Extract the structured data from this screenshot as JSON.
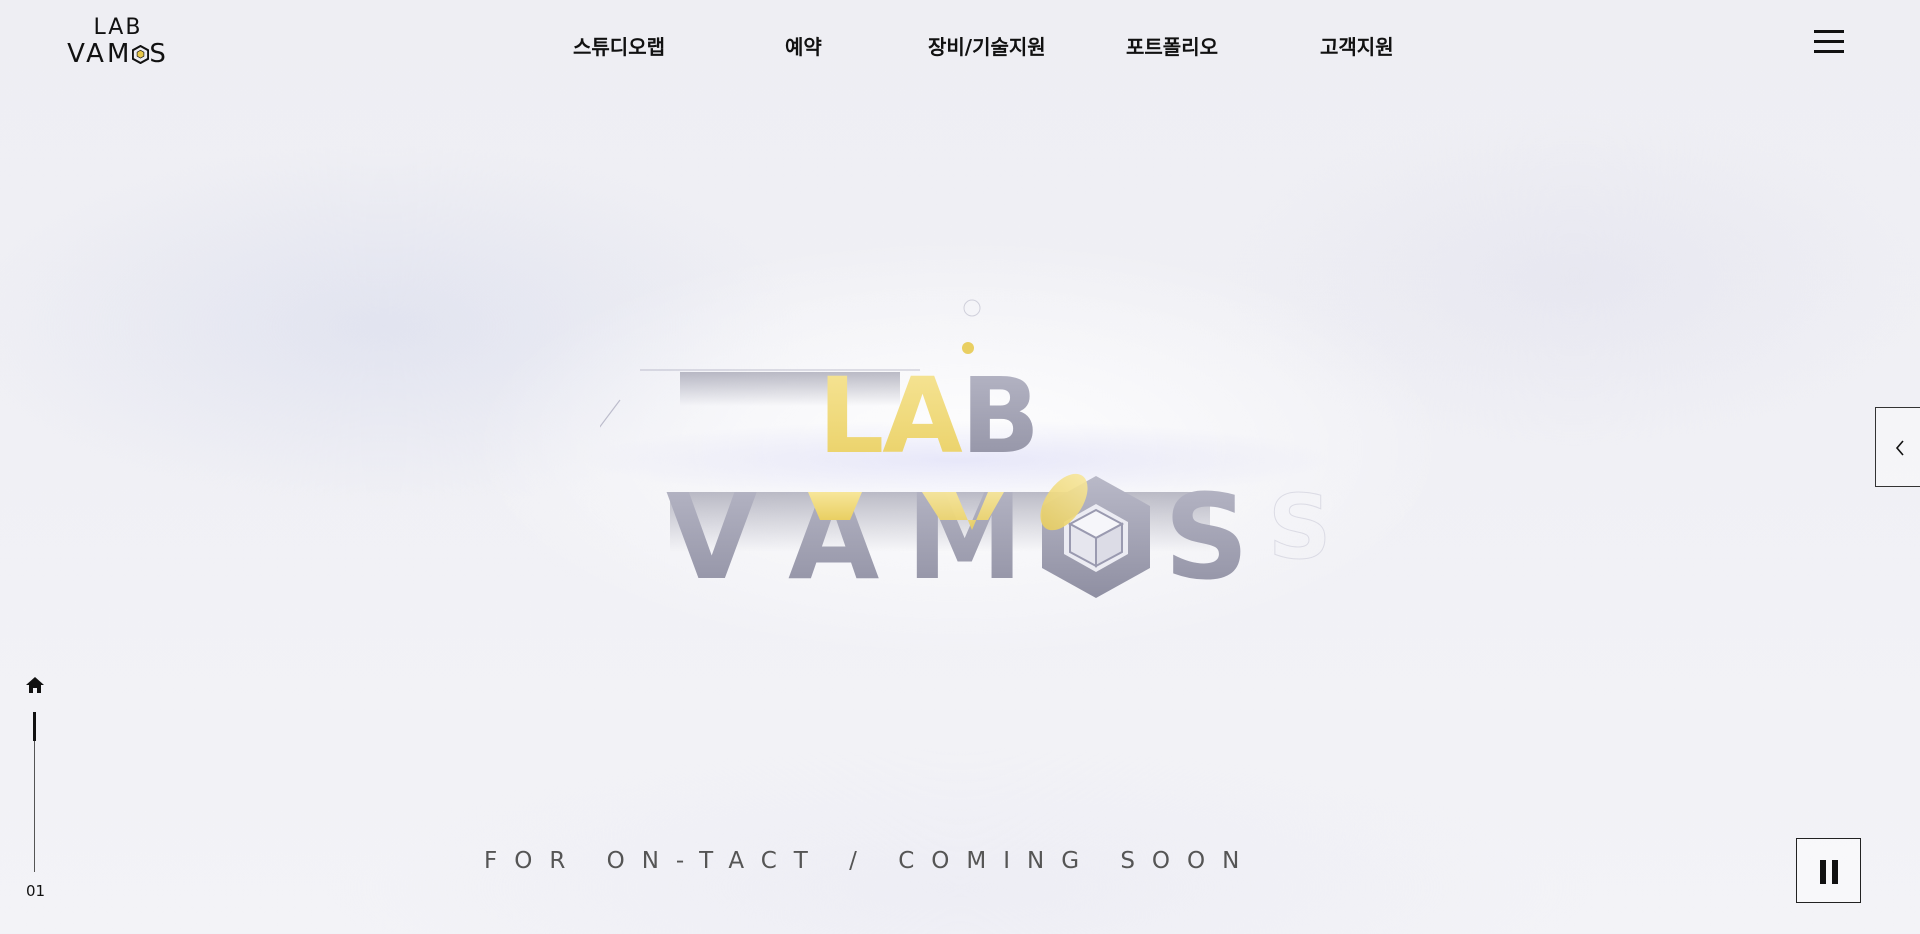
{
  "header": {
    "logo": {
      "line1": "LAB",
      "line2_left": "VAM",
      "line2_right": "S"
    },
    "nav": [
      {
        "label": "스튜디오랩"
      },
      {
        "label": "예약"
      },
      {
        "label": "장비/기술지원"
      },
      {
        "label": "포트폴리오"
      },
      {
        "label": "고객지원"
      }
    ],
    "menu_icon": "hamburger-menu-icon"
  },
  "hero": {
    "line1": "LAB",
    "line2_left": "V",
    "line2_a": "A",
    "line2_m": "M",
    "line2_s": "S",
    "tagline": "FOR ON-TACT / COMING SOON",
    "colors": {
      "yellow": "#f2dd7a",
      "silver": "#a6a6b8",
      "background": "#f0f0f5"
    }
  },
  "indicator": {
    "home_icon": "home-icon",
    "slide_number": "01",
    "progress": 0.18
  },
  "controls": {
    "side_tab_icon": "chevron-left-icon",
    "pause_icon": "pause-icon"
  }
}
